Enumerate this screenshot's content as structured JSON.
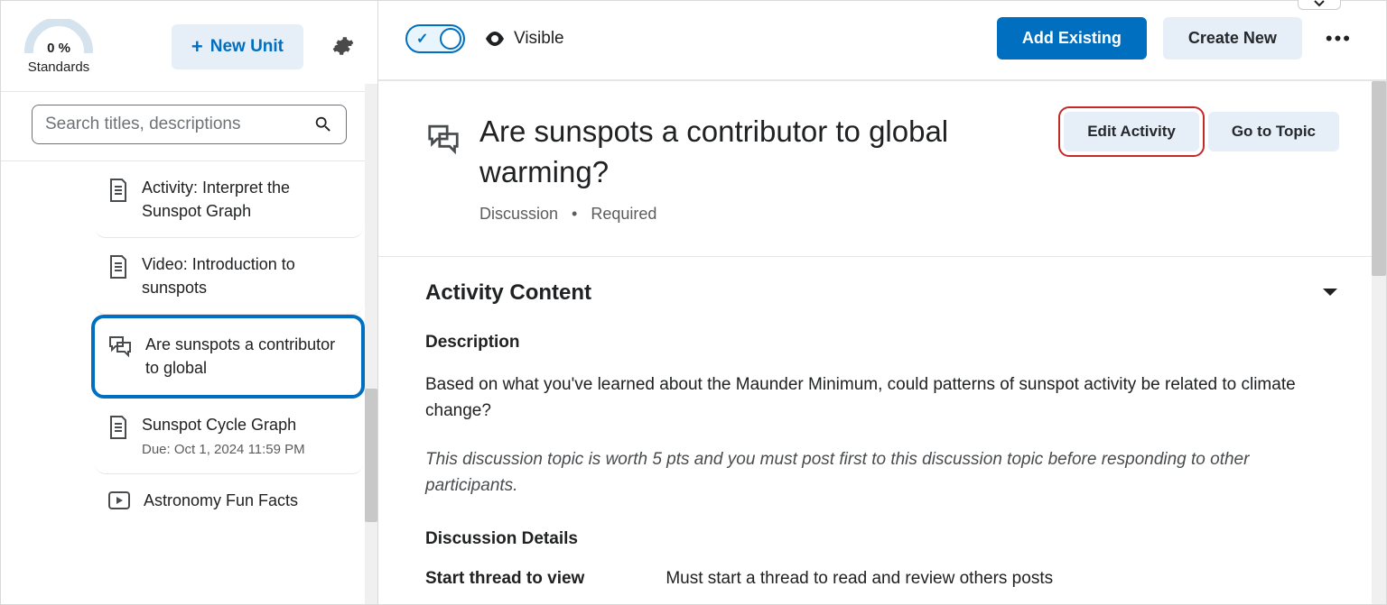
{
  "sidebar": {
    "standards_pct": "0 %",
    "standards_label": "Standards",
    "new_unit_label": "New Unit",
    "search_placeholder": "Search titles, descriptions",
    "items": [
      {
        "icon": "doc",
        "title": "Activity: Interpret the Sunspot Graph"
      },
      {
        "icon": "doc",
        "title": "Video: Introduction to sunspots"
      },
      {
        "icon": "discussion",
        "title": "Are sunspots a contributor to global",
        "selected": true
      },
      {
        "icon": "doc",
        "title": "Sunspot Cycle Graph",
        "due": "Due: Oct 1, 2024 11:59 PM"
      },
      {
        "icon": "video",
        "title": "Astronomy Fun Facts"
      }
    ]
  },
  "toolbar": {
    "visibility_label": "Visible",
    "add_existing": "Add Existing",
    "create_new": "Create New"
  },
  "page": {
    "title": "Are sunspots a contributor to global warming?",
    "type": "Discussion",
    "required": "Required",
    "edit_activity": "Edit Activity",
    "go_to_topic": "Go to Topic"
  },
  "activity": {
    "section_title": "Activity Content",
    "description_label": "Description",
    "description_text": "Based on what you've learned about the Maunder Minimum, could patterns of sunspot activity be related to climate change?",
    "description_note": "This discussion topic is worth 5 pts and you must post first to this discussion topic before responding to other participants.",
    "details_label": "Discussion Details",
    "detail_key": "Start thread to view",
    "detail_val": "Must start a thread to read and review others posts"
  }
}
